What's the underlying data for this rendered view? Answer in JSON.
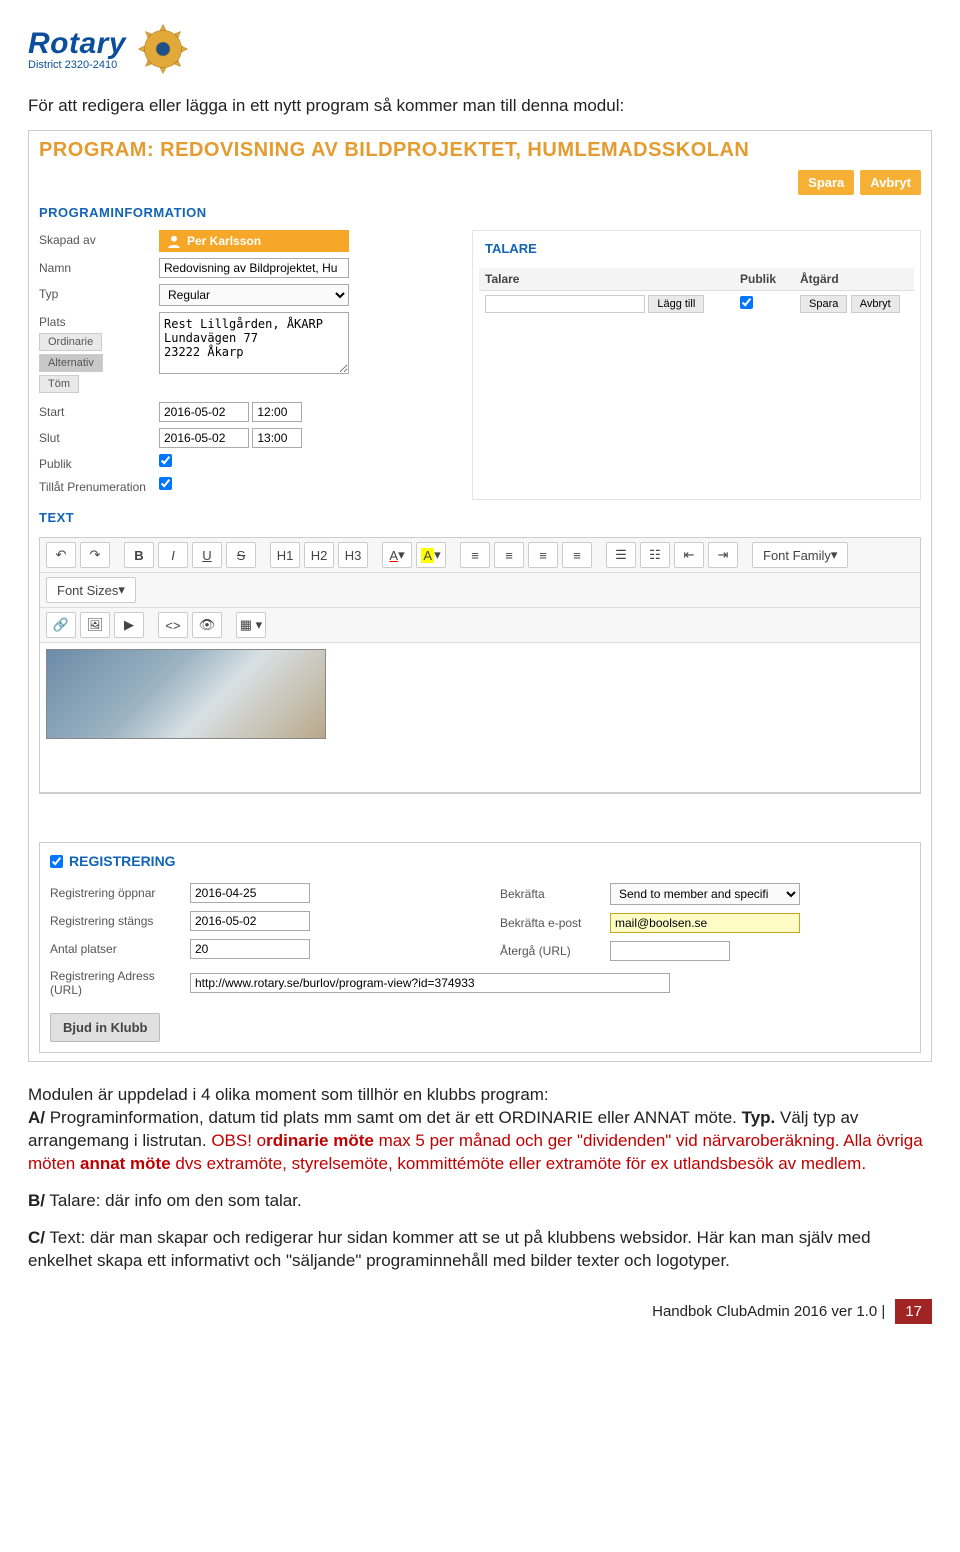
{
  "logo": {
    "word": "Rotary",
    "sub": "District 2320-2410"
  },
  "intro": "För att redigera eller lägga in ett nytt program så kommer man till denna modul:",
  "app": {
    "title": "PROGRAM: REDOVISNING AV BILDPROJEKTET, HUMLEMADSSKOLAN",
    "save": "Spara",
    "cancel": "Avbryt",
    "programinfo_h": "PROGRAMINFORMATION",
    "labels": {
      "skapad": "Skapad av",
      "namn": "Namn",
      "typ": "Typ",
      "plats": "Plats",
      "start": "Start",
      "slut": "Slut",
      "publik": "Publik",
      "tillat": "Tillåt Prenumeration"
    },
    "user": "Per Karlsson",
    "namn_val": "Redovisning av Bildprojektet, Hu",
    "typ_val": "Regular",
    "plats_tags": {
      "ordinarie": "Ordinarie",
      "alternativ": "Alternativ",
      "tom": "Töm"
    },
    "plats_text": "Rest Lillgården, ÅKARP\nLundavägen 77\n23222 Åkarp",
    "start_date": "2016-05-02",
    "start_time": "12:00",
    "slut_date": "2016-05-02",
    "slut_time": "13:00",
    "talare_h": "TALARE",
    "talare_cols": {
      "talare": "Talare",
      "publik": "Publik",
      "atgard": "Åtgärd"
    },
    "talare_btns": {
      "lagg": "Lägg till",
      "spara": "Spara",
      "avbryt": "Avbryt"
    },
    "text_h": "TEXT",
    "toolbar": {
      "bold": "B",
      "italic": "I",
      "underline": "U",
      "strike": "S",
      "h1": "H1",
      "h2": "H2",
      "h3": "H3",
      "textcolor": "A",
      "bgcolor": "A",
      "fontfamily": "Font Family",
      "fontsizes": "Font Sizes"
    },
    "reg_h": "REGISTRERING",
    "reg": {
      "oppnar_l": "Registrering öppnar",
      "oppnar_v": "2016-04-25",
      "stangs_l": "Registrering stängs",
      "stangs_v": "2016-05-02",
      "antal_l": "Antal platser",
      "antal_v": "20",
      "url_l": "Registrering Adress (URL)",
      "url_v": "http://www.rotary.se/burlov/program-view?id=374933",
      "bekrafta_l": "Bekräfta",
      "bekrafta_v": "Send to member and specifi",
      "epost_l": "Bekräfta e-post",
      "epost_v": "mail@boolsen.se",
      "aterga_l": "Återgå (URL)",
      "aterga_v": "",
      "bjud": "Bjud in Klubb"
    }
  },
  "body": {
    "p1a": "Modulen är uppdelad i 4 olika moment som tillhör en klubbs program:",
    "p1_bA": "A/",
    "p1b": " Programinformation, datum tid plats mm samt om det är ett ORDINARIE eller ANNAT möte. ",
    "p1_bTyp": "Typ.",
    "p1c": " Välj typ av arrangemang i listrutan. ",
    "p1_obs": "OBS! o",
    "p1_red1b": "rdinarie möte",
    "p1_red1": " max 5 per månad och ger \"dividenden\" vid närvaroberäkning. Alla övriga möten ",
    "p1_red2b": "annat möte",
    "p1_red2": " dvs extramöte, styrelsemöte, kommittémöte eller extramöte för ex utlandsbesök av medlem.",
    "p2_b": "B/",
    "p2": " Talare: där info om den som talar.",
    "p3_b": "C/",
    "p3": " Text: där man skapar och redigerar hur sidan kommer att se ut på klubbens websidor. Här kan man själv med enkelhet skapa ett informativt och \"säljande\" programinnehåll med bilder texter och logotyper."
  },
  "footer": {
    "text": "Handbok ClubAdmin 2016 ver 1.0 |",
    "page": "17"
  }
}
